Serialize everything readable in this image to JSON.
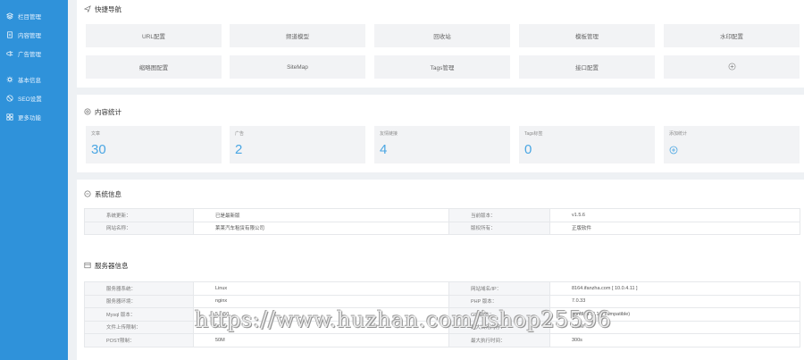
{
  "sidebar": {
    "items": [
      {
        "label": "栏目管理",
        "icon": "layers-icon"
      },
      {
        "label": "内容管理",
        "icon": "document-icon"
      },
      {
        "label": "广告管理",
        "icon": "ad-icon"
      },
      {
        "label": "基本信息",
        "icon": "gear-icon"
      },
      {
        "label": "SEO设置",
        "icon": "seo-icon"
      },
      {
        "label": "更多功能",
        "icon": "grid-icon"
      }
    ]
  },
  "quick_nav": {
    "title": "快捷导航",
    "buttons": [
      "URL配置",
      "频道模型",
      "回收站",
      "模板管理",
      "水印配置",
      "缩略图配置",
      "SiteMap",
      "Tags管理",
      "接口配置"
    ]
  },
  "stats": {
    "title": "内容统计",
    "cards": [
      {
        "label": "文章",
        "value": "30"
      },
      {
        "label": "广告",
        "value": "2"
      },
      {
        "label": "友情链接",
        "value": "4"
      },
      {
        "label": "Tags标签",
        "value": "0"
      },
      {
        "label": "添加统计",
        "value": ""
      }
    ]
  },
  "system_info": {
    "title": "系统信息",
    "rows": [
      [
        "系统更新：",
        "已是最新版",
        "当前版本：",
        "v1.5.6"
      ],
      [
        "网站名称：",
        "莱莱汽车租赁有限公司",
        "版权所有：",
        "正版软件"
      ]
    ]
  },
  "server_info": {
    "title": "服务器信息",
    "rows": [
      [
        "服务器系统：",
        "Linux",
        "网站域名/IP：",
        "8164.ifanzha.com [ 10.0.4.11 ]"
      ],
      [
        "服务器环境：",
        "nginx",
        "PHP 版本：",
        "7.0.33"
      ],
      [
        "Mysql 版本：",
        "5.6.50",
        "GD 版本：",
        "bundled (2.1.0 compatible)"
      ],
      [
        "文件上传限制：",
        "50M",
        "最大占用内存：",
        "128M"
      ],
      [
        "POST限制：",
        "50M",
        "最大执行时间：",
        "300s"
      ]
    ]
  },
  "watermark": "https://www.huzhan.com/ishop25596",
  "colors": {
    "sidebar": "#2f92da",
    "accent": "#4aa6e3",
    "page_bg": "#eef1f4"
  }
}
